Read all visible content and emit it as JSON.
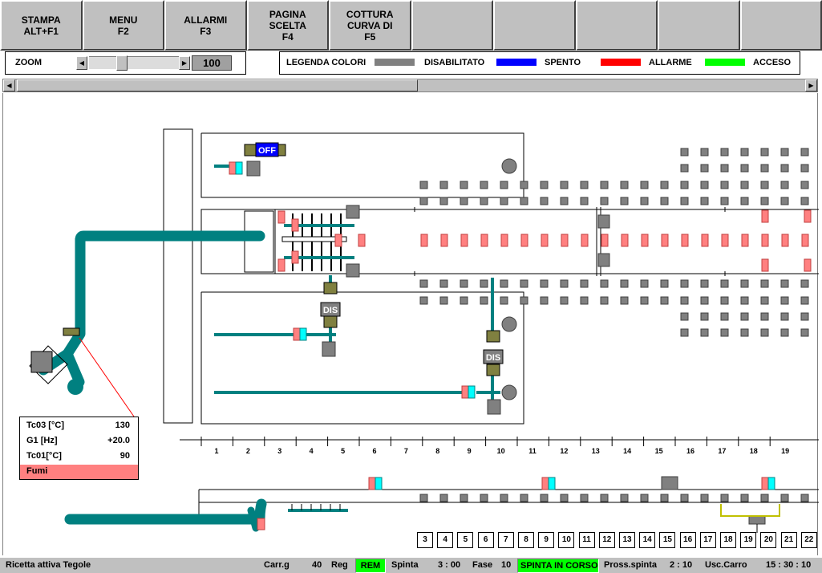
{
  "function_keys": [
    {
      "line1": "STAMPA",
      "line2": "ALT+F1"
    },
    {
      "line1": "MENU",
      "line2": "F2"
    },
    {
      "line1": "ALLARMI",
      "line2": "F3"
    },
    {
      "line1": "PAGINA",
      "line2": "SCELTA",
      "line3": "F4"
    },
    {
      "line1": "COTTURA",
      "line2": "CURVA DI",
      "line3": "F5"
    },
    {
      "line1": ""
    },
    {
      "line1": ""
    },
    {
      "line1": ""
    },
    {
      "line1": ""
    },
    {
      "line1": ""
    }
  ],
  "zoom": {
    "label": "ZOOM",
    "value": "100"
  },
  "legend": {
    "title": "LEGENDA COLORI",
    "items": [
      {
        "label": "DISABILITATO",
        "color": "#808080"
      },
      {
        "label": "SPENTO",
        "color": "#0000ff"
      },
      {
        "label": "ALLARME",
        "color": "#ff0000"
      },
      {
        "label": "ACCESO",
        "color": "#00ff00"
      }
    ]
  },
  "synoptic": {
    "valve_badges": [
      "OFF",
      "DIS",
      "DIS"
    ],
    "params": [
      {
        "name": "Tc03 [°C]",
        "value": "130"
      },
      {
        "name": "G1   [Hz]",
        "value": "+20.0"
      },
      {
        "name": "Tc01[°C]",
        "value": "90"
      }
    ],
    "alarm_label": "Fumi",
    "scale_numbers": [
      "1",
      "2",
      "3",
      "4",
      "5",
      "6",
      "7",
      "8",
      "9",
      "10",
      "11",
      "12",
      "13",
      "14",
      "15",
      "16",
      "17",
      "18",
      "19"
    ],
    "cart_numbers": [
      "3",
      "4",
      "5",
      "6",
      "7",
      "8",
      "9",
      "10",
      "11",
      "12",
      "13",
      "14",
      "15",
      "16",
      "17",
      "18",
      "19",
      "20",
      "21",
      "22"
    ]
  },
  "status": {
    "recipe": "Ricetta attiva  Tegole",
    "carrelli_label": "Carr.g",
    "carrelli_value": "40",
    "reg_label": "Reg",
    "rem": "REM",
    "spinta_label": "Spinta",
    "spinta_value": "3 : 00",
    "fase_label": "Fase",
    "fase_value": "10",
    "state": "SPINTA IN CORSO",
    "prossima_label": "Pross.spinta",
    "prossima_value": "2 : 10",
    "uscita_label": "Usc.Carro",
    "clock": "15 : 30 : 10"
  },
  "colors": {
    "pipe": "#008080",
    "disabled": "#808080",
    "alarm_pink": "#ff8080",
    "cyan": "#00ffff",
    "valve": "#808040",
    "off_blue": "#0000ff",
    "active_green": "#00ff00"
  }
}
